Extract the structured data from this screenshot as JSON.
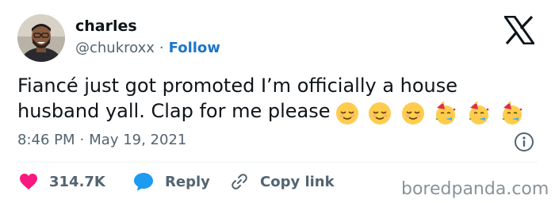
{
  "user": {
    "name": "charles",
    "handle": "@chukroxx",
    "separator": "·",
    "follow_label": "Follow",
    "avatar_icon": "profile-photo"
  },
  "tweet": {
    "text": "Fiancé just got promoted I’m officially a house husband yall. Clap for me please",
    "emojis": [
      "relieved-face",
      "relieved-face",
      "relieved-face",
      "partying-face",
      "partying-face",
      "partying-face"
    ],
    "time": "8:46 PM",
    "separator": "·",
    "date": "May 19, 2021"
  },
  "actions": {
    "likes": "314.7K",
    "reply_label": "Reply",
    "copy_link_label": "Copy link"
  },
  "watermark": "boredpanda.com",
  "colors": {
    "text": "#0f1419",
    "muted": "#536471",
    "follow": "#1d75c9",
    "like": "#f91880",
    "reply": "#1d9bf0",
    "divider": "#eff3f4"
  }
}
